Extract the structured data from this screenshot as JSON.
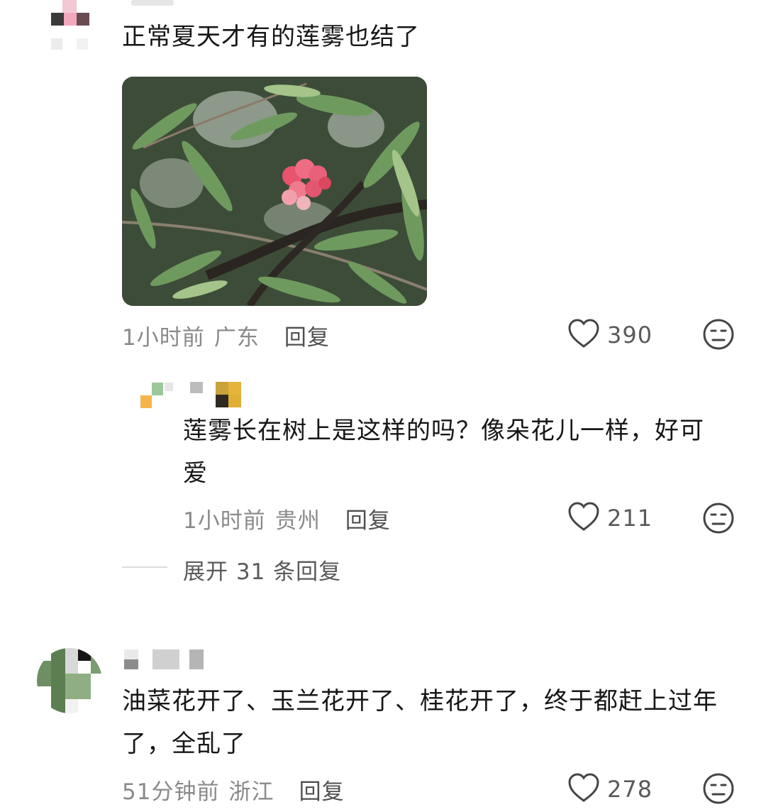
{
  "comments": [
    {
      "text": "正常夏天才有的莲雾也结了",
      "time": "1小时前",
      "location": "广东",
      "reply_label": "回复",
      "likes": "390",
      "has_image": true,
      "replies": [
        {
          "text": "莲雾长在树上是这样的吗？像朵花儿一样，好可爱",
          "time": "1小时前",
          "location": "贵州",
          "reply_label": "回复",
          "likes": "211"
        }
      ],
      "expand_label": "展开 31 条回复"
    },
    {
      "text": "油菜花开了、玉兰花开了、桂花开了，终于都赶上过年了，全乱了",
      "time": "51分钟前",
      "location": "浙江",
      "reply_label": "回复",
      "likes": "278"
    }
  ],
  "icons": {
    "like": "heart-outline-icon",
    "dislike": "meh-face-icon"
  },
  "colors": {
    "text": "#161616",
    "meta": "#8a8a8a",
    "icon": "#444444"
  }
}
